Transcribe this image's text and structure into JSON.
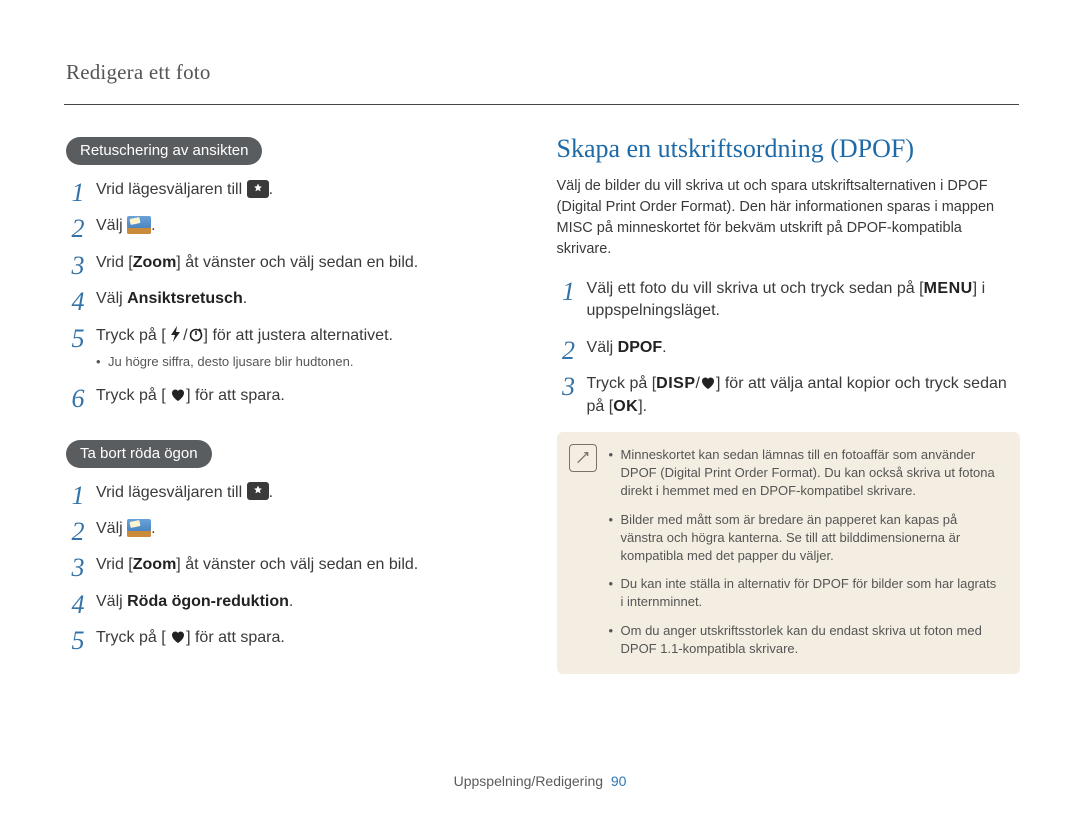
{
  "header": {
    "title": "Redigera ett foto"
  },
  "left": {
    "section1": {
      "pill": "Retuschering av ansikten",
      "steps": [
        {
          "pre": "Vrid lägesväljaren till ",
          "icon": "mode-magic",
          "post": "."
        },
        {
          "pre": "Välj ",
          "icon": "edit-photo",
          "post": "."
        },
        {
          "pre": "Vrid [",
          "bold1": "Zoom",
          "mid": "] åt vänster och välj sedan en bild."
        },
        {
          "pre": "Välj ",
          "bold1": "Ansiktsretusch",
          "post": "."
        },
        {
          "pre": "Tryck på [",
          "icon": "flash",
          "sep": "/",
          "icon2": "timer",
          "post": "] för att justera alternativet.",
          "sub": "Ju högre siffra, desto ljusare blir hudtonen."
        },
        {
          "pre": "Tryck på [",
          "icon": "macro",
          "post": "] för att spara."
        }
      ]
    },
    "section2": {
      "pill": "Ta bort röda ögon",
      "steps": [
        {
          "pre": "Vrid lägesväljaren till ",
          "icon": "mode-magic",
          "post": "."
        },
        {
          "pre": "Välj ",
          "icon": "edit-photo",
          "post": "."
        },
        {
          "pre": "Vrid [",
          "bold1": "Zoom",
          "mid": "] åt vänster och välj sedan en bild."
        },
        {
          "pre": "Välj ",
          "bold1": "Röda ögon-reduktion",
          "post": "."
        },
        {
          "pre": "Tryck på [",
          "icon": "macro",
          "post": "] för att spara."
        }
      ]
    }
  },
  "right": {
    "heading": "Skapa en utskriftsordning (DPOF)",
    "intro": "Välj de bilder du vill skriva ut och spara utskriftsalternativen i DPOF (Digital Print Order Format). Den här informationen sparas i mappen MISC på minneskortet för bekväm utskrift på DPOF-kompatibla skrivare.",
    "steps": [
      {
        "pre": "Välj ett foto du vill skriva ut och tryck sedan på [",
        "key": "MENU",
        "post": "] i uppspelningsläget."
      },
      {
        "pre": "Välj ",
        "bold1": "DPOF",
        "post": "."
      },
      {
        "pre": "Tryck på [",
        "key": "DISP",
        "sep": "/",
        "icon": "macro",
        "mid": "] för att välja antal kopior och tryck sedan på [",
        "key2": "OK",
        "post": "]."
      }
    ],
    "notes": [
      "Minneskortet kan sedan lämnas till en fotoaffär som använder DPOF (Digital Print Order Format). Du kan också skriva ut fotona direkt i hemmet med en DPOF-kompatibel skrivare.",
      "Bilder med mått som är bredare än papperet kan kapas på vänstra och högra kanterna. Se till att bilddimensionerna är kompatibla med det papper du väljer.",
      "Du kan inte ställa in alternativ för DPOF för bilder som har lagrats i internminnet.",
      "Om du anger utskriftsstorlek kan du endast skriva ut foton med DPOF 1.1-kompatibla skrivare."
    ]
  },
  "footer": {
    "section": "Uppspelning/Redigering",
    "page": "90"
  }
}
